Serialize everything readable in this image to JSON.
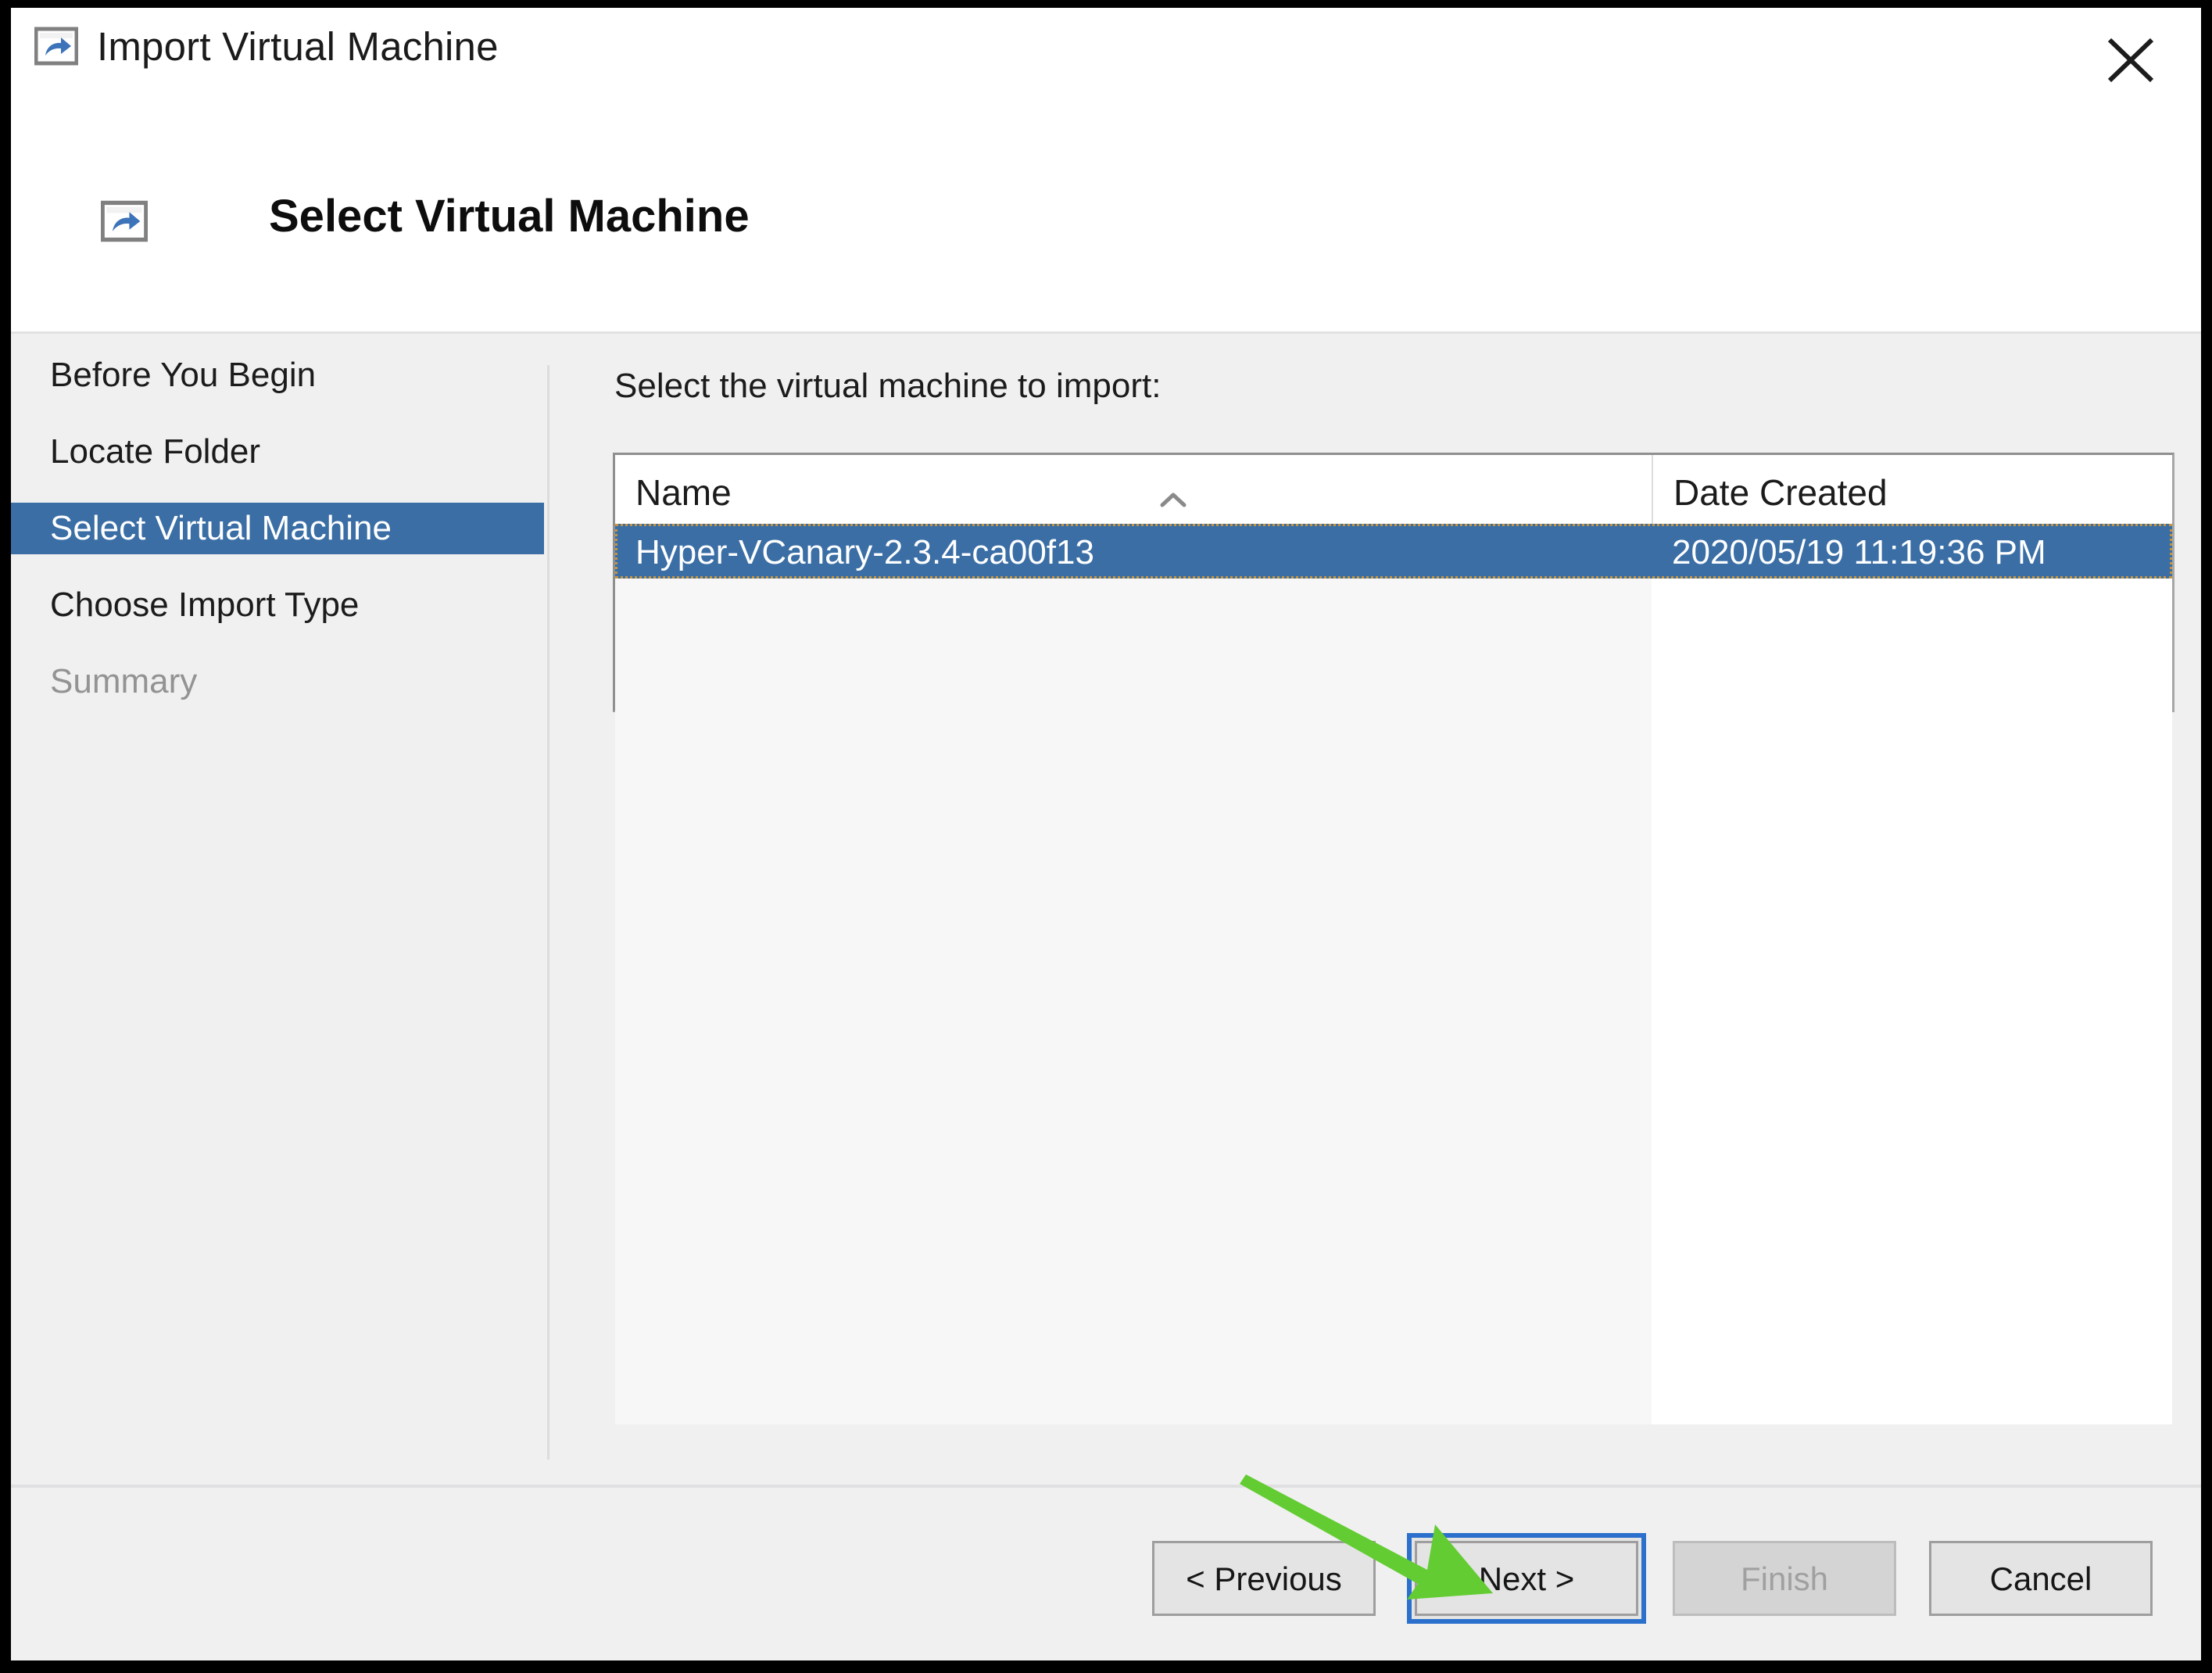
{
  "window": {
    "title": "Import Virtual Machine",
    "title_icon": "import-vm-icon",
    "close_icon": "close-icon"
  },
  "banner": {
    "title": "Select Virtual Machine",
    "icon": "import-vm-icon"
  },
  "sidebar": {
    "items": [
      {
        "label": "Before You Begin",
        "state": "normal"
      },
      {
        "label": "Locate Folder",
        "state": "normal"
      },
      {
        "label": "Select Virtual Machine",
        "state": "selected"
      },
      {
        "label": "Choose Import Type",
        "state": "normal"
      },
      {
        "label": "Summary",
        "state": "disabled"
      }
    ]
  },
  "main": {
    "instruction": "Select the virtual machine to import:",
    "list": {
      "columns": [
        {
          "label": "Name",
          "sort": "ascending",
          "sort_icon": "chevron-up-icon"
        },
        {
          "label": "Date Created",
          "sort": "none"
        }
      ],
      "rows": [
        {
          "name": "Hyper-VCanary-2.3.4-ca00f13",
          "date_created": "2020/05/19 11:19:36 PM",
          "selected": true
        }
      ]
    }
  },
  "footer": {
    "buttons": [
      {
        "label": "< Previous",
        "state": "enabled"
      },
      {
        "label": "Next >",
        "state": "focused"
      },
      {
        "label": "Finish",
        "state": "disabled"
      },
      {
        "label": "Cancel",
        "state": "enabled"
      }
    ]
  },
  "annotation": {
    "arrow": "green-arrow-pointing-to-next-button",
    "color": "#63cc33"
  },
  "colors": {
    "selection_blue": "#3a6ea5",
    "focus_blue": "#2a70cc",
    "window_bg": "#f0f0f0",
    "header_bg": "#ffffff",
    "annotation_green": "#63cc33",
    "disabled_text": "#939393"
  }
}
